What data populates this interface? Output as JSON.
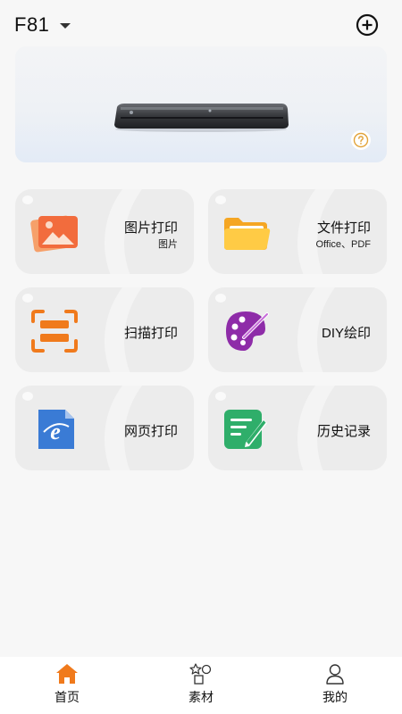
{
  "header": {
    "device_name": "F81"
  },
  "features": [
    {
      "title": "图片打印",
      "subtitle": "图片"
    },
    {
      "title": "文件打印",
      "subtitle": "Office、PDF"
    },
    {
      "title": "扫描打印"
    },
    {
      "title": "DIY绘印"
    },
    {
      "title": "网页打印"
    },
    {
      "title": "历史记录"
    }
  ],
  "tabs": [
    {
      "label": "首页",
      "active": true
    },
    {
      "label": "素材",
      "active": false
    },
    {
      "label": "我的",
      "active": false
    }
  ],
  "colors": {
    "accent": "#f07a1c",
    "background": "#f7f7f7",
    "card": "#ececec"
  }
}
